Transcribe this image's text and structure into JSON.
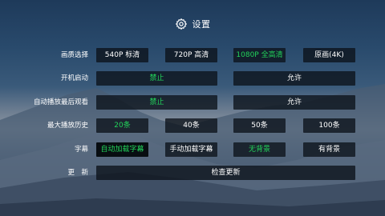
{
  "header": {
    "icon": "gear-icon",
    "title": "设置"
  },
  "colors": {
    "selected_text": "#22d35a",
    "option_bg": "#0c121a"
  },
  "settings": [
    {
      "label": "画质选择",
      "options": [
        {
          "text": "540P 标清",
          "selected": false
        },
        {
          "text": "720P 高清",
          "selected": false
        },
        {
          "text": "1080P 全高清",
          "selected": true
        },
        {
          "text": "原画(4K)",
          "selected": false
        }
      ]
    },
    {
      "label": "开机启动",
      "options": [
        {
          "text": "禁止",
          "selected": true
        },
        {
          "text": "允许",
          "selected": false
        }
      ]
    },
    {
      "label": "自动播放最后观看",
      "options": [
        {
          "text": "禁止",
          "selected": true
        },
        {
          "text": "允许",
          "selected": false
        }
      ]
    },
    {
      "label": "最大播放历史",
      "options": [
        {
          "text": "20条",
          "selected": true
        },
        {
          "text": "40条",
          "selected": false
        },
        {
          "text": "50条",
          "selected": false
        },
        {
          "text": "100条",
          "selected": false
        }
      ]
    },
    {
      "label": "字幕",
      "options": [
        {
          "text": "自动加载字幕",
          "selected": true
        },
        {
          "text": "手动加载字幕",
          "selected": false
        },
        {
          "text": "无背景",
          "selected": true
        },
        {
          "text": "有背景",
          "selected": false
        }
      ]
    },
    {
      "label": "更　新",
      "options": [
        {
          "text": "检查更新",
          "selected": false
        }
      ]
    }
  ]
}
